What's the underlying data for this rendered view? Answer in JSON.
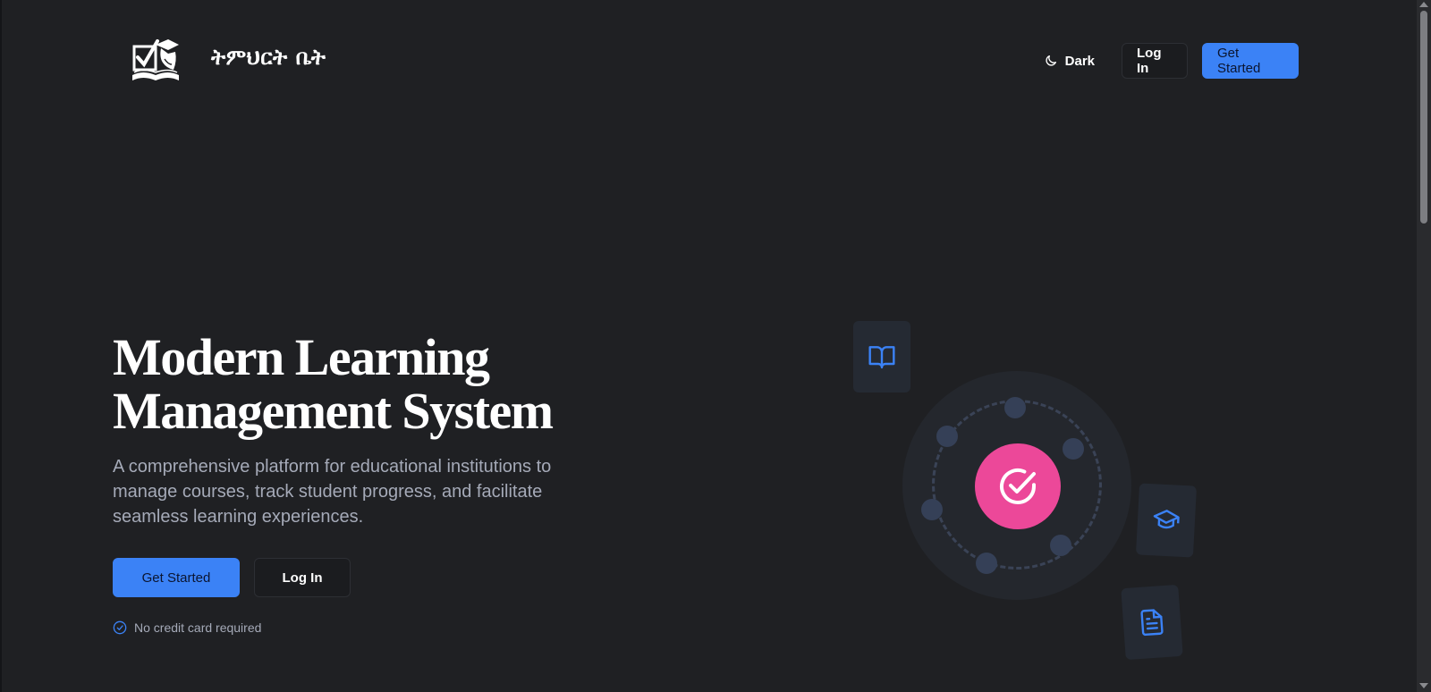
{
  "header": {
    "brand": "ትምህርት ቤት",
    "theme_toggle_label": "Dark",
    "login_label": "Log In",
    "get_started_label": "Get Started"
  },
  "hero": {
    "title_line1": "Modern Learning",
    "title_line2": "Management System",
    "description": "A comprehensive platform for educational institutions to manage courses, track student progress, and facilitate seamless learning experiences.",
    "primary_cta": "Get Started",
    "secondary_cta": "Log In",
    "note": "No credit card required"
  },
  "illustration": {
    "center_icon": "check-circle-icon",
    "cards": [
      "book-open-icon",
      "graduation-cap-icon",
      "file-text-icon"
    ]
  },
  "colors": {
    "background": "#1f2023",
    "primary": "#3b82f6",
    "accent_pink": "#ec4899",
    "muted_text": "#a5aab8"
  }
}
